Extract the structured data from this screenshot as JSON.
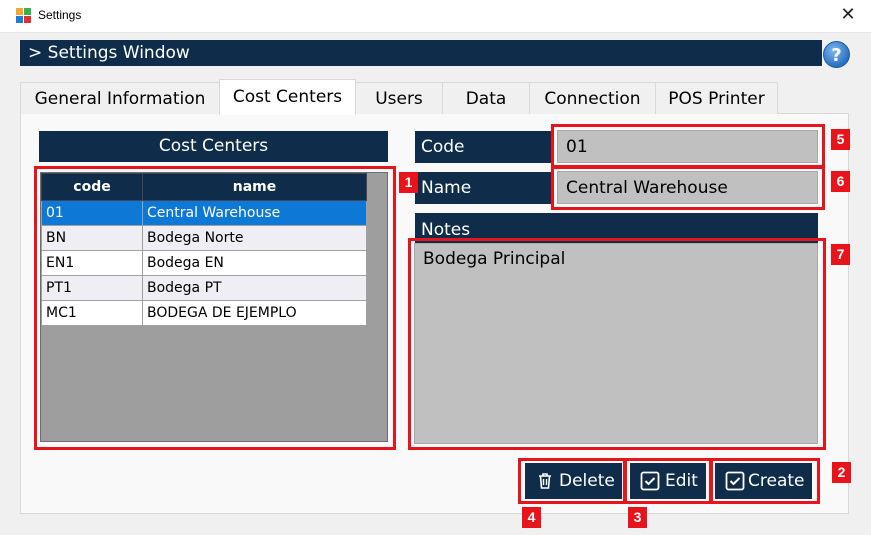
{
  "window": {
    "title": "Settings",
    "close_glyph": "✕",
    "app_icon": "app-logo-icon"
  },
  "header": {
    "title": "> Settings Window",
    "help_glyph": "?"
  },
  "tabs": [
    {
      "label": "General Information",
      "active": false
    },
    {
      "label": "Cost Centers",
      "active": true
    },
    {
      "label": "Users",
      "active": false
    },
    {
      "label": "Data",
      "active": false
    },
    {
      "label": "Connection",
      "active": false
    },
    {
      "label": "POS Printer",
      "active": false
    }
  ],
  "list": {
    "title": "Cost Centers",
    "columns": [
      "code",
      "name"
    ],
    "rows": [
      {
        "code": "01",
        "name": "Central Warehouse",
        "selected": true
      },
      {
        "code": "BN",
        "name": "Bodega Norte",
        "selected": false
      },
      {
        "code": "EN1",
        "name": "Bodega EN",
        "selected": false
      },
      {
        "code": "PT1",
        "name": "Bodega PT",
        "selected": false
      },
      {
        "code": "MC1",
        "name": "BODEGA DE EJEMPLO",
        "selected": false
      }
    ]
  },
  "form": {
    "code_label": "Code",
    "code_value": "01",
    "name_label": "Name",
    "name_value": "Central Warehouse",
    "notes_label": "Notes",
    "notes_value": "Bodega Principal"
  },
  "buttons": {
    "delete": {
      "label": "Delete",
      "icon": "trash-icon"
    },
    "edit": {
      "label": "Edit",
      "icon": "checkbox-icon"
    },
    "create": {
      "label": "Create",
      "icon": "checkbox-icon"
    }
  },
  "annotations": [
    "1",
    "2",
    "3",
    "4",
    "5",
    "6",
    "7"
  ],
  "colors": {
    "header_navy": "#0f2d4a",
    "selection_blue": "#0d78d6",
    "field_gray": "#c0c0c0",
    "annotation_red": "#e8141b"
  }
}
